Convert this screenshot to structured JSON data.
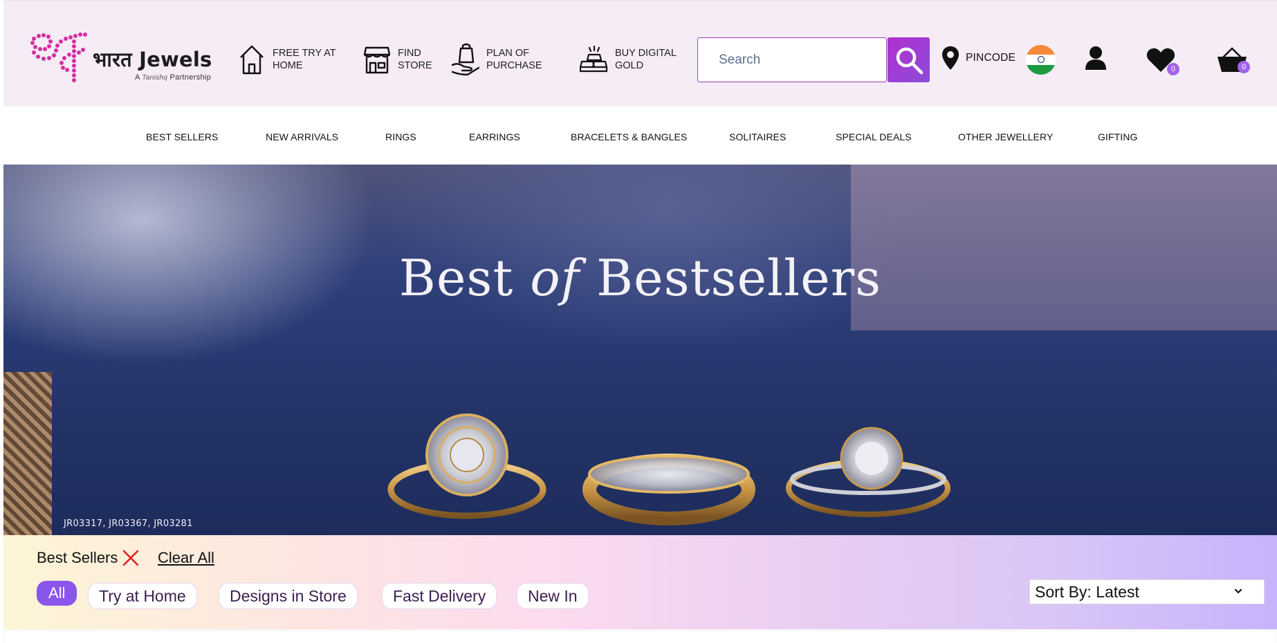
{
  "brand": {
    "name": "भारत Jewels",
    "subtitle_prefix": "A",
    "subtitle_partner": "Tanishq",
    "subtitle_suffix": "Partnership",
    "logo_icon": "devanagari-bha-logo",
    "accent_color": "#c4309a"
  },
  "header": {
    "links": [
      {
        "label": "FREE TRY AT HOME",
        "icon": "home-icon"
      },
      {
        "label": "FIND STORE",
        "icon": "store-icon"
      },
      {
        "label": "PLAN OF PURCHASE",
        "icon": "shopping-bag-hand-icon"
      },
      {
        "label": "BUY DIGITAL GOLD",
        "icon": "gold-bars-icon"
      }
    ],
    "search": {
      "placeholder": "Search",
      "button_color": "#a43ed4"
    },
    "pincode_label": "PINCODE",
    "country_flag": "india-flag",
    "wishlist_count": "0",
    "cart_count": "0",
    "badge_color": "#a163e8"
  },
  "nav": {
    "items": [
      "BEST SELLERS",
      "NEW ARRIVALS",
      "RINGS",
      "EARRINGS",
      "BRACELETS & BANGLES",
      "SOLITAIRES",
      "SPECIAL DEALS",
      "OTHER JEWELLERY",
      "GIFTING"
    ]
  },
  "banner": {
    "title_pre": "Best ",
    "title_italic": "of",
    "title_post": " Bestsellers",
    "product_codes": "JR03317, JR03367, JR03281"
  },
  "filters": {
    "applied": "Best Sellers",
    "clear_all": "Clear All",
    "chips": [
      "All",
      "Try at Home",
      "Designs in Store",
      "Fast Delivery",
      "New In"
    ],
    "active_chip": "All",
    "sort_label": "Sort By: Latest",
    "active_color": "#8a55ea"
  }
}
